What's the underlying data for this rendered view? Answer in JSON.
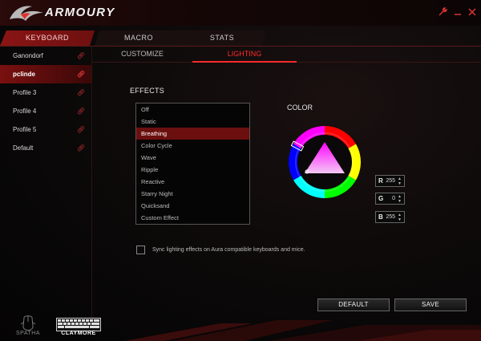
{
  "app": {
    "title": "ARMOURY"
  },
  "titlebar": {
    "settings_icon": "wrench-icon",
    "minimize_icon": "minimize-icon",
    "close_icon": "close-icon"
  },
  "top_tabs": [
    {
      "label": "KEYBOARD",
      "active": true
    },
    {
      "label": "MACRO",
      "active": false
    },
    {
      "label": "STATS",
      "active": false
    }
  ],
  "profiles": [
    {
      "label": "Ganondorf",
      "active": false
    },
    {
      "label": "pclinde",
      "active": true
    },
    {
      "label": "Profile 3",
      "active": false
    },
    {
      "label": "Profile 4",
      "active": false
    },
    {
      "label": "Profile 5",
      "active": false
    },
    {
      "label": "Default",
      "active": false
    }
  ],
  "sub_tabs": [
    {
      "label": "CUSTOMIZE",
      "active": false
    },
    {
      "label": "LIGHTING",
      "active": true
    }
  ],
  "effects": {
    "label": "EFFECTS",
    "items": [
      "Off",
      "Static",
      "Breathing",
      "Color Cycle",
      "Wave",
      "Ripple",
      "Reactive",
      "Starry Night",
      "Quicksand",
      "Custom Effect"
    ],
    "selected": "Breathing"
  },
  "color": {
    "label": "COLOR",
    "r": {
      "label": "R",
      "value": "255"
    },
    "g": {
      "label": "G",
      "value": "0"
    },
    "b": {
      "label": "B",
      "value": "255"
    },
    "selected_hex": "#ff00ff"
  },
  "sync": {
    "label": "Sync lighting effects on Aura compatible keyboards and mice.",
    "checked": false
  },
  "buttons": {
    "default": "DEFAULT",
    "save": "SAVE"
  },
  "devices": [
    {
      "label": "SPATHA",
      "active": false
    },
    {
      "label": "CLAYMORE",
      "active": true
    }
  ],
  "colors": {
    "accent": "#ff2a2a",
    "active_tab": "#8a1414",
    "selection": "#6b0f0f"
  }
}
